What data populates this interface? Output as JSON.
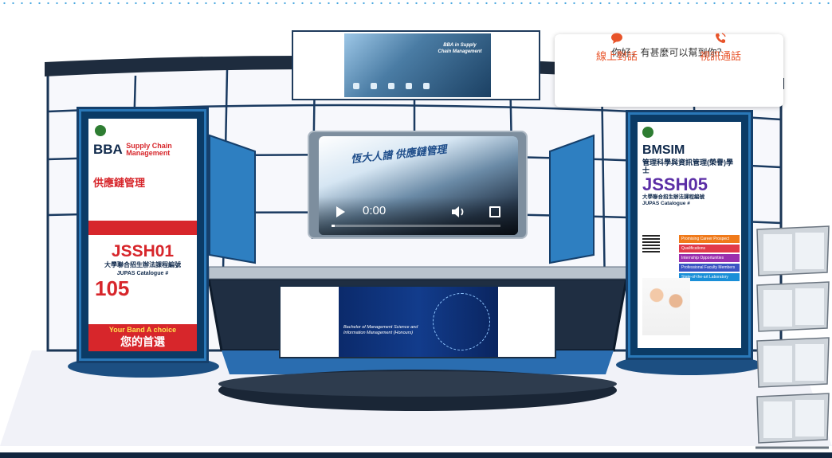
{
  "chat": {
    "greeting": "你好，有甚麼可以幫到你？",
    "online_label": "線上對話",
    "video_label": "視訊通話",
    "accent_color": "#e8542a"
  },
  "video_player": {
    "title": "恆大人譜 供應鏈管理",
    "time": "0:00",
    "progress": 0.02
  },
  "top_screen": {
    "title": "BBA in Supply Chain Management"
  },
  "left_poster": {
    "title_line1": "BBA",
    "title_line2": "Supply Chain Management",
    "chinese_title": "供應鏈管理",
    "code": "JSSH01",
    "jupas_label": "大學聯合招生辦法課程編號",
    "jupas_catalogue": "JUPAS Catalogue #",
    "number": "105",
    "footer_en": "Your Band A choice",
    "footer_zh": "您的首選"
  },
  "right_poster": {
    "title": "BMSIM",
    "chinese_title": "管理科學與資訊管理(榮譽)學士",
    "code": "JSSH05",
    "jupas_label": "大學聯合招生辦法課程編號",
    "jupas_catalogue": "JUPAS Catalogue #",
    "features": [
      "Promising Career Prospect",
      "Qualifications",
      "Internship Opportunities",
      "Professional Faculty Members",
      "State-of-the-art Laboratory"
    ]
  },
  "counter_screen": {
    "title": "Bachelor of Management Science and Information Management (Honours)"
  }
}
